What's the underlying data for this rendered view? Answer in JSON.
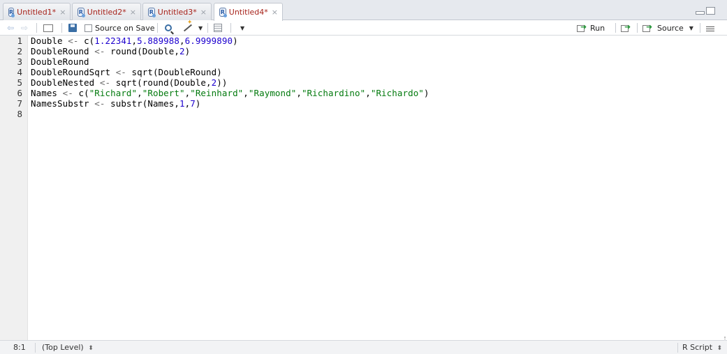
{
  "tabs": [
    {
      "label": "Untitled1*",
      "active": false
    },
    {
      "label": "Untitled2*",
      "active": false
    },
    {
      "label": "Untitled3*",
      "active": false
    },
    {
      "label": "Untitled4*",
      "active": true
    }
  ],
  "tab_icon_letter": "R",
  "tab_close_glyph": "×",
  "toolbar": {
    "source_on_save_label": "Source on Save",
    "source_on_save_checked": false,
    "run_label": "Run",
    "source_label": "Source"
  },
  "editor": {
    "line_numbers": [
      "1",
      "2",
      "3",
      "4",
      "5",
      "6",
      "7",
      "8"
    ],
    "lines": [
      [
        {
          "t": "Double ",
          "c": ""
        },
        {
          "t": "<-",
          "c": "op"
        },
        {
          "t": " c(",
          "c": ""
        },
        {
          "t": "1.22341",
          "c": "num"
        },
        {
          "t": ",",
          "c": ""
        },
        {
          "t": "5.889988",
          "c": "num"
        },
        {
          "t": ",",
          "c": ""
        },
        {
          "t": "6.9999890",
          "c": "num"
        },
        {
          "t": ")",
          "c": ""
        }
      ],
      [
        {
          "t": "DoubleRound ",
          "c": ""
        },
        {
          "t": "<-",
          "c": "op"
        },
        {
          "t": " round(Double,",
          "c": ""
        },
        {
          "t": "2",
          "c": "num"
        },
        {
          "t": ")",
          "c": ""
        }
      ],
      [
        {
          "t": "DoubleRound",
          "c": ""
        }
      ],
      [
        {
          "t": "DoubleRoundSqrt ",
          "c": ""
        },
        {
          "t": "<-",
          "c": "op"
        },
        {
          "t": " sqrt(DoubleRound)",
          "c": ""
        }
      ],
      [
        {
          "t": "DoubleNested ",
          "c": ""
        },
        {
          "t": "<-",
          "c": "op"
        },
        {
          "t": " sqrt(round(Double,",
          "c": ""
        },
        {
          "t": "2",
          "c": "num"
        },
        {
          "t": "))",
          "c": ""
        }
      ],
      [
        {
          "t": "Names ",
          "c": ""
        },
        {
          "t": "<-",
          "c": "op"
        },
        {
          "t": " c(",
          "c": ""
        },
        {
          "t": "\"Richard\"",
          "c": "str"
        },
        {
          "t": ",",
          "c": ""
        },
        {
          "t": "\"Robert\"",
          "c": "str"
        },
        {
          "t": ",",
          "c": ""
        },
        {
          "t": "\"Reinhard\"",
          "c": "str"
        },
        {
          "t": ",",
          "c": ""
        },
        {
          "t": "\"Raymond\"",
          "c": "str"
        },
        {
          "t": ",",
          "c": ""
        },
        {
          "t": "\"Richardino\"",
          "c": "str"
        },
        {
          "t": ",",
          "c": ""
        },
        {
          "t": "\"Richardo\"",
          "c": "str"
        },
        {
          "t": ")",
          "c": ""
        }
      ],
      [
        {
          "t": "NamesSubstr ",
          "c": ""
        },
        {
          "t": "<-",
          "c": "op"
        },
        {
          "t": " substr(Names,",
          "c": ""
        },
        {
          "t": "1",
          "c": "num"
        },
        {
          "t": ",",
          "c": ""
        },
        {
          "t": "7",
          "c": "num"
        },
        {
          "t": ")",
          "c": ""
        }
      ],
      []
    ]
  },
  "status": {
    "cursor_position": "8:1",
    "scope": "(Top Level)",
    "file_type": "R Script",
    "updown_glyph": "⬍"
  },
  "colors": {
    "tab_text": "#a7231b",
    "string": "#037a0e",
    "number": "#1c00cf",
    "operator": "#686868"
  },
  "icons": [
    "back-arrow-icon",
    "forward-arrow-icon",
    "show-in-window-icon",
    "save-icon",
    "find-icon",
    "code-tools-wand-icon",
    "compile-report-icon",
    "more-menu-icon",
    "run-icon",
    "rerun-icon",
    "source-icon",
    "outline-icon",
    "minimize-icon",
    "maximize-icon"
  ]
}
